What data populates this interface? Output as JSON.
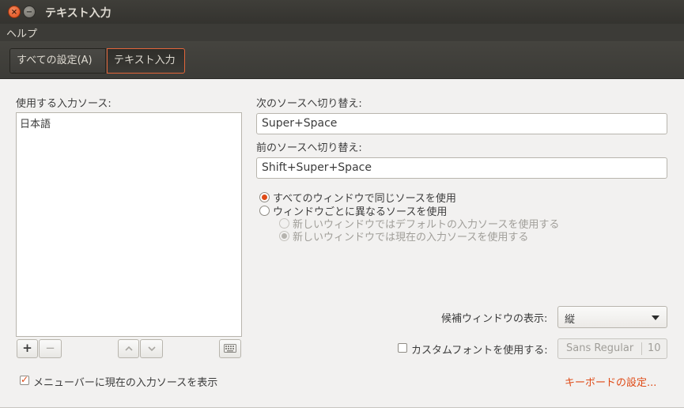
{
  "window": {
    "title": "テキスト入力"
  },
  "menu": {
    "help": "ヘルプ"
  },
  "breadcrumbs": {
    "all_settings": "すべての設定(A)",
    "current": "テキスト入力"
  },
  "sources": {
    "label": "使用する入力ソース:",
    "items": [
      "日本語"
    ]
  },
  "next_source": {
    "label": "次のソースへ切り替え:",
    "value": "Super+Space"
  },
  "prev_source": {
    "label": "前のソースへ切り替え:",
    "value": "Shift+Super+Space"
  },
  "mode": {
    "same_label": "すべてのウィンドウで同じソースを使用",
    "per_window_label": "ウィンドウごとに異なるソースを使用",
    "sub_default_label": "新しいウィンドウではデフォルトの入力ソースを使用する",
    "sub_current_label": "新しいウィンドウでは現在の入力ソースを使用する"
  },
  "candidate": {
    "label": "候補ウィンドウの表示:",
    "value": "縦"
  },
  "custom_font": {
    "label": "カスタムフォントを使用する:",
    "font_name": "Sans Regular",
    "font_size": "10"
  },
  "show_menubar": {
    "label": "メニューバーに現在の入力ソースを表示",
    "checked": true
  },
  "keyboard_link": "キーボードの設定...",
  "colors": {
    "accent": "#df4a16",
    "titlebar": "#3c3b37",
    "background": "#f2f1f0"
  },
  "icons": {
    "close": "close-icon",
    "minimize": "minimize-icon",
    "add": "plus-icon",
    "remove": "minus-icon",
    "up": "chevron-up-icon",
    "down": "chevron-down-icon",
    "keyboard": "keyboard-icon"
  }
}
